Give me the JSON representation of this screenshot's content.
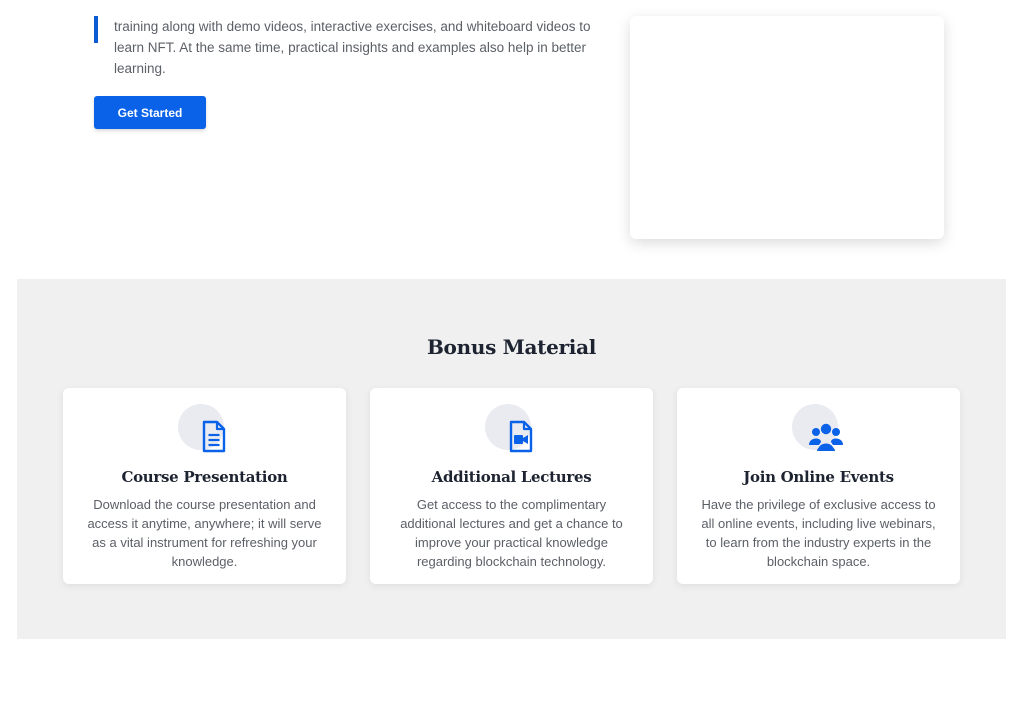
{
  "intro": {
    "text": "training along with demo videos, interactive exercises, and whiteboard videos to learn NFT. At the same time, practical insights and examples also help in better learning.",
    "cta_label": "Get Started"
  },
  "bonus": {
    "title": "Bonus Material",
    "cards": [
      {
        "icon": "document-icon",
        "title": "Course Presentation",
        "description": "Download the course presentation and access it anytime, anywhere; it will serve as a vital instrument for refreshing your knowledge."
      },
      {
        "icon": "video-file-icon",
        "title": "Additional Lectures",
        "description": "Get access to the complimentary additional lectures and get a chance to improve your practical knowledge regarding blockchain technology."
      },
      {
        "icon": "users-group-icon",
        "title": "Join Online Events",
        "description": "Have the privilege of exclusive access to all online events, including live webinars, to learn from the industry experts in the blockchain space."
      }
    ]
  },
  "colors": {
    "accent": "#0a62e8",
    "section_bg": "#f0f0f0",
    "heading": "#1d2330",
    "body_text": "#5b5f66"
  }
}
